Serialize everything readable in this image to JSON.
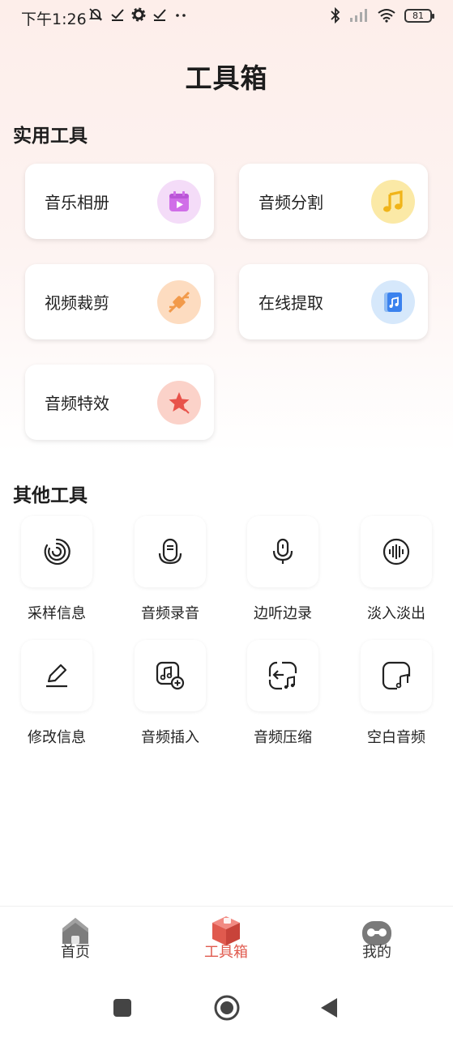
{
  "status_bar": {
    "time": "下午1:26",
    "battery": "81",
    "left_icons": [
      "muted-bell-icon",
      "check-icon",
      "gear-icon",
      "check-icon",
      "more-dots-icon"
    ],
    "right_icons": [
      "bluetooth-icon",
      "signal-icon",
      "wifi-icon",
      "battery-icon"
    ]
  },
  "page_title": "工具箱",
  "practical_tools": {
    "title": "实用工具",
    "items": [
      {
        "label": "音乐相册",
        "icon": "photo-album-icon",
        "color": "#c874e6"
      },
      {
        "label": "音频分割",
        "icon": "music-note-icon",
        "color": "#f7c43a"
      },
      {
        "label": "视频裁剪",
        "icon": "cut-icon",
        "color": "#f29a4a"
      },
      {
        "label": "在线提取",
        "icon": "music-file-icon",
        "color": "#4a8fef"
      },
      {
        "label": "音频特效",
        "icon": "star-icon",
        "color": "#e8524a"
      }
    ]
  },
  "other_tools": {
    "title": "其他工具",
    "items": [
      {
        "label": "采样信息",
        "icon": "sample-icon"
      },
      {
        "label": "音频录音",
        "icon": "record-icon"
      },
      {
        "label": "边听边录",
        "icon": "microphone-icon"
      },
      {
        "label": "淡入淡出",
        "icon": "waveform-icon"
      },
      {
        "label": "修改信息",
        "icon": "edit-icon"
      },
      {
        "label": "音频插入",
        "icon": "insert-music-icon"
      },
      {
        "label": "音频压缩",
        "icon": "compress-icon"
      },
      {
        "label": "空白音频",
        "icon": "blank-audio-icon"
      }
    ]
  },
  "bottom_nav": {
    "items": [
      {
        "label": "首页",
        "icon": "home-icon"
      },
      {
        "label": "工具箱",
        "icon": "toolbox-icon",
        "active": true
      },
      {
        "label": "我的",
        "icon": "profile-icon"
      }
    ]
  },
  "colors": {
    "accent": "#e05a4e",
    "background_top": "#fdeeea"
  }
}
